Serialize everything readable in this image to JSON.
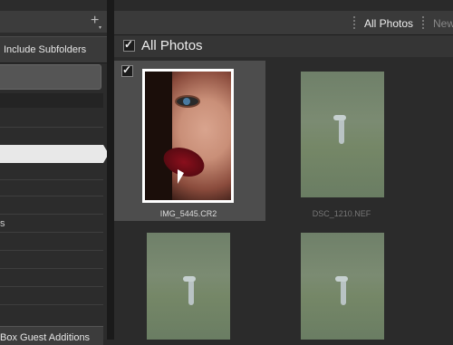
{
  "left_panel": {
    "include_subfolders_label": "Include Subfolders",
    "row_text": "s",
    "bottom_button_label": "Box Guest Additions"
  },
  "top_nav": {
    "all_photos_label": "All Photos",
    "new_label": "New"
  },
  "grid_header": {
    "title": "All Photos"
  },
  "photos": [
    {
      "filename": "IMG_5445.CR2",
      "selected": true,
      "checked": true
    },
    {
      "filename": "DSC_1210.NEF",
      "selected": false,
      "checked": false
    },
    {
      "filename": "",
      "selected": false,
      "checked": false
    },
    {
      "filename": "",
      "selected": false,
      "checked": false
    }
  ]
}
